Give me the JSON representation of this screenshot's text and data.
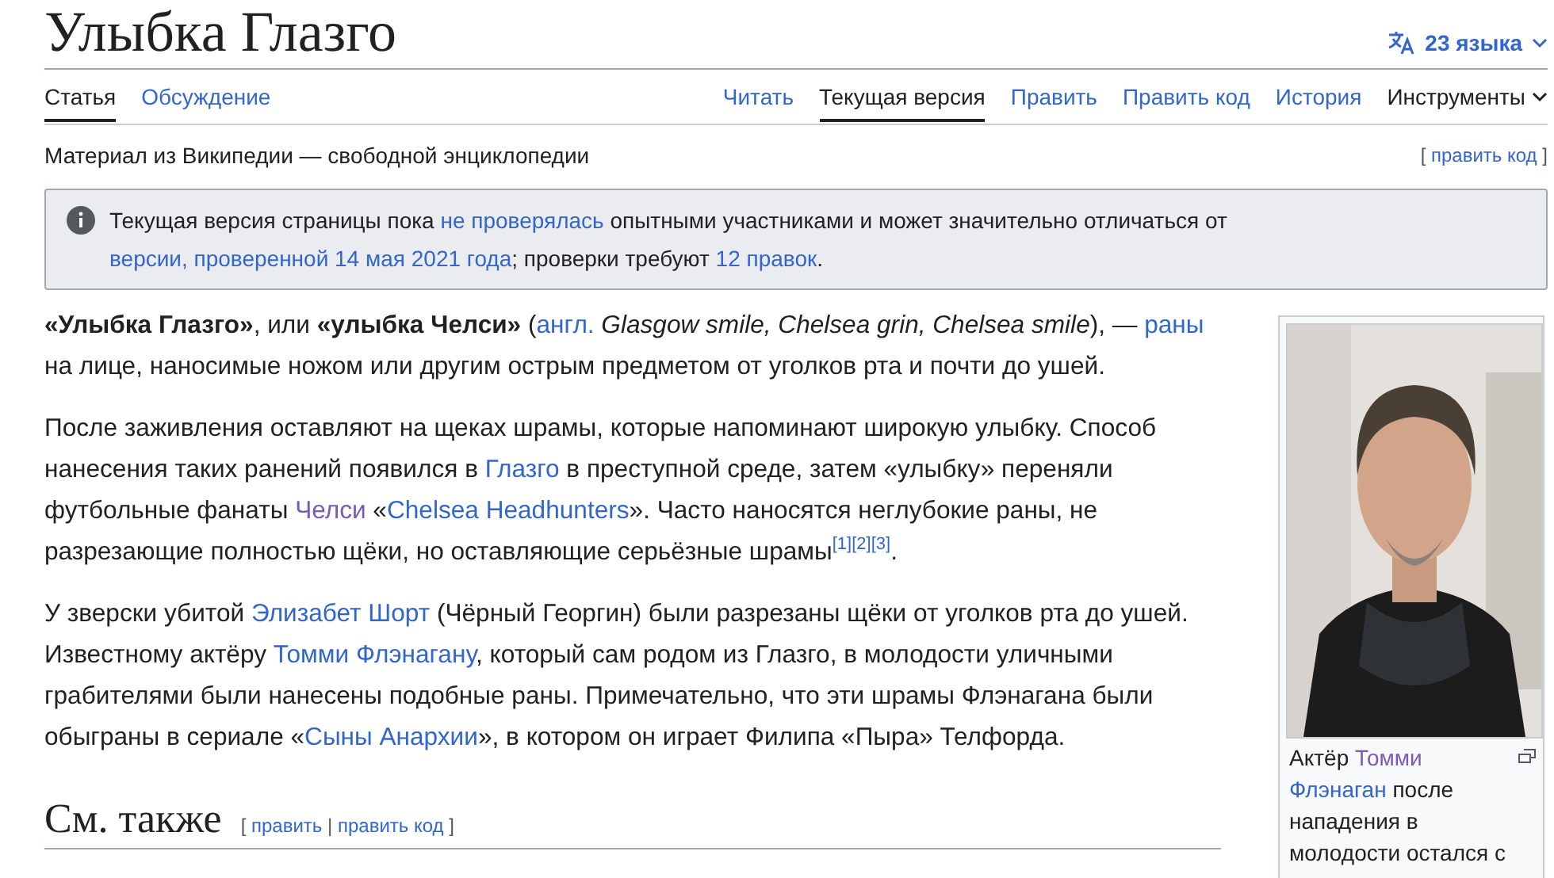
{
  "title": "Улыбка Глазго",
  "languages": {
    "label": "23 языка"
  },
  "tabs_left": [
    {
      "label": "Статья",
      "selected": true
    },
    {
      "label": "Обсуждение",
      "selected": false
    }
  ],
  "tabs_right": [
    {
      "label": "Читать",
      "selected": false,
      "kind": "link"
    },
    {
      "label": "Текущая версия",
      "selected": true,
      "kind": "link"
    },
    {
      "label": "Править",
      "selected": false,
      "kind": "link"
    },
    {
      "label": "Править код",
      "selected": false,
      "kind": "link"
    },
    {
      "label": "История",
      "selected": false,
      "kind": "link"
    },
    {
      "label": "Инструменты",
      "selected": false,
      "kind": "menu"
    }
  ],
  "tagline": "Материал из Википедии — свободной энциклопедии",
  "tagline_edit": {
    "open": "[",
    "link": "править код",
    "close": "]"
  },
  "notice": [
    {
      "kind": "plain",
      "text": "Текущая версия страницы пока "
    },
    {
      "kind": "link",
      "text": "не проверялась"
    },
    {
      "kind": "plain",
      "text": " опытными участниками и может значительно отличаться от "
    },
    {
      "kind": "link",
      "text": "версии, проверенной 14 мая 2021 года"
    },
    {
      "kind": "plain",
      "text": "; проверки требуют "
    },
    {
      "kind": "link",
      "text": "12 правок"
    },
    {
      "kind": "plain",
      "text": "."
    }
  ],
  "paragraphs": [
    [
      {
        "kind": "bold",
        "text": "«Улыбка Глазго»"
      },
      {
        "kind": "plain",
        "text": ", или "
      },
      {
        "kind": "bold",
        "text": "«улыбка Челси»"
      },
      {
        "kind": "plain",
        "text": " ("
      },
      {
        "kind": "link",
        "text": "англ."
      },
      {
        "kind": "italic",
        "text": " Glasgow smile, Chelsea grin, Chelsea smile"
      },
      {
        "kind": "plain",
        "text": "), — "
      },
      {
        "kind": "link",
        "text": "раны"
      },
      {
        "kind": "plain",
        "text": " на лице, наносимые ножом или другим острым предметом от уголков рта и почти до ушей."
      }
    ],
    [
      {
        "kind": "plain",
        "text": "После заживления оставляют на щеках шрамы, которые напоминают широкую улыбку. Способ нанесения таких ранений появился в "
      },
      {
        "kind": "link",
        "text": "Глазго"
      },
      {
        "kind": "plain",
        "text": " в преступной среде, затем «улыбку» переняли футбольные фанаты "
      },
      {
        "kind": "visited",
        "text": "Челси"
      },
      {
        "kind": "plain",
        "text": " «"
      },
      {
        "kind": "link",
        "text": "Chelsea Headhunters"
      },
      {
        "kind": "plain",
        "text": "». Часто наносятся неглубокие раны, не разрезающие полностью щёки, но оставляющие серьёзные шрамы"
      },
      {
        "kind": "ref",
        "text": "[1]"
      },
      {
        "kind": "ref",
        "text": "[2]"
      },
      {
        "kind": "ref",
        "text": "[3]"
      },
      {
        "kind": "plain",
        "text": "."
      }
    ],
    [
      {
        "kind": "plain",
        "text": "У зверски убитой "
      },
      {
        "kind": "link",
        "text": "Элизабет Шорт"
      },
      {
        "kind": "plain",
        "text": " (Чёрный Георгин) были разрезаны щёки от уголков рта до ушей. Известному актёру "
      },
      {
        "kind": "link",
        "text": "Томми Флэнагану"
      },
      {
        "kind": "plain",
        "text": ", который сам родом из Глазго, в молодости уличными грабителями были нанесены подобные раны. Примечательно, что эти шрамы Флэнагана были обыграны в сериале «"
      },
      {
        "kind": "link",
        "text": "Сыны Анархии"
      },
      {
        "kind": "plain",
        "text": "», в котором он играет Филипа «Пыра» Телфорда."
      }
    ]
  ],
  "section": {
    "title": "См. также",
    "open": "[",
    "edit": "править",
    "separator": "|",
    "edit_code": "править код",
    "close": "]"
  },
  "figure": {
    "caption": [
      {
        "kind": "plain",
        "text": "Актёр "
      },
      {
        "kind": "visited",
        "text": "Томми "
      },
      {
        "kind": "link",
        "text": "Флэнаган"
      },
      {
        "kind": "plain",
        "text": " после нападения в молодости остался с"
      }
    ]
  }
}
